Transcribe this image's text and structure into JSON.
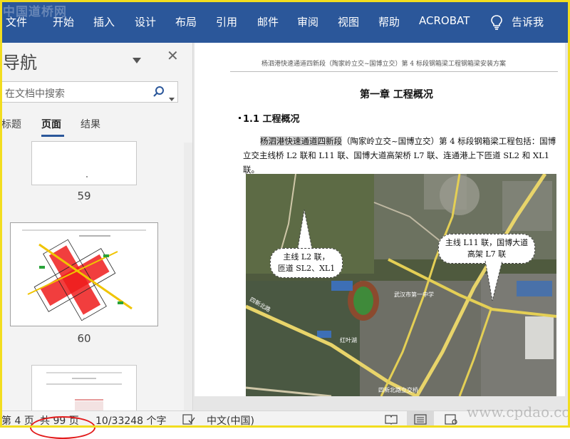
{
  "watermark_logo": "中国道桥网",
  "ribbon": {
    "tabs": [
      "文件",
      "开始",
      "插入",
      "设计",
      "布局",
      "引用",
      "邮件",
      "审阅",
      "视图",
      "帮助",
      "ACROBAT"
    ],
    "tell_me": "告诉我"
  },
  "nav": {
    "title": "导航",
    "search_placeholder": "在文档中搜索",
    "tabs": [
      "标题",
      "页面",
      "结果"
    ],
    "active_tab": "页面",
    "thumbnails": [
      {
        "page": "59"
      },
      {
        "page": "60"
      },
      {
        "page": ""
      }
    ]
  },
  "document": {
    "header": "杨泗港快速通道四新段（陶家岭立交~国博立交）第 4 标段钢箱梁工程钢箱梁安装方案",
    "chapter": "第一章  工程概况",
    "section": "1.1  工程概况",
    "para_highlight": "杨泗港快速通道四新段",
    "para_rest": "（陶家岭立交~国博立交）第 4 标段钢箱梁工程包括：国博立交主线桥 L2 联和 L11 联、国博大道高架桥 L7 联、连通港上下匝道 SL2 和 XL1 联。",
    "callout_left_1": "主线 L2 联，",
    "callout_left_2": "匝道 SL2、XL1",
    "callout_right_1": "主线 L11 联，国博大道",
    "callout_right_2": "高架 L7 联",
    "map_labels": [
      "四新北路",
      "四新北路立交桥",
      "武汉市第一中学",
      "红叶湖"
    ]
  },
  "status": {
    "page": "第 4 页",
    "total": "共 99 页",
    "words": "10/33248 个字",
    "language": "中文(中国)"
  },
  "site_watermark": "www.cpdao.com",
  "colors": {
    "ribbon": "#2b579a",
    "frame": "#f2dd1f",
    "annotation": "#e21b1b"
  }
}
